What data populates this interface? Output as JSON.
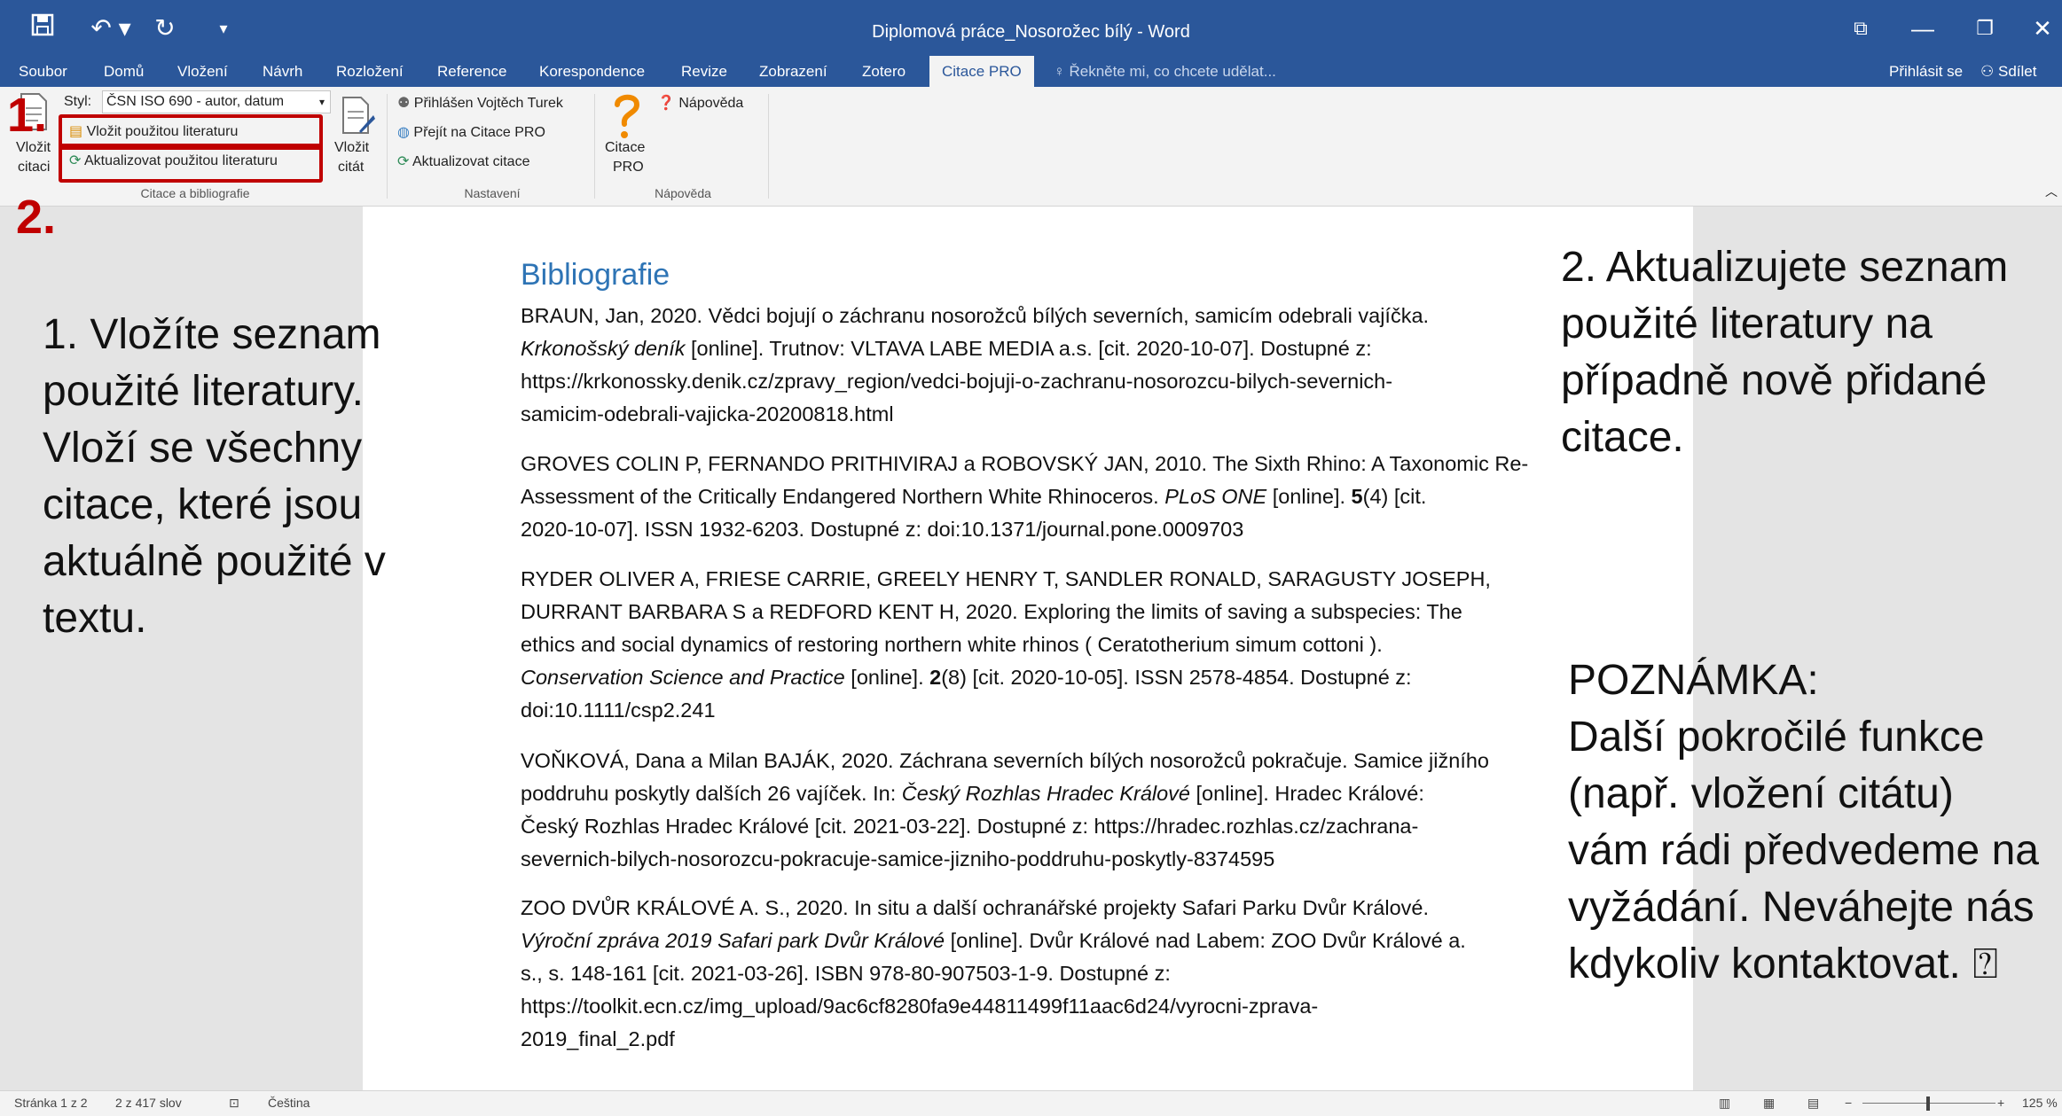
{
  "window": {
    "title": "Diplomová práce_Nosorožec bílý - Word"
  },
  "tabs": [
    "Soubor",
    "Domů",
    "Vložení",
    "Návrh",
    "Rozložení",
    "Reference",
    "Korespondence",
    "Revize",
    "Zobrazení",
    "Zotero",
    "Citace PRO"
  ],
  "tellme": "Řekněte mi, co chcete udělat...",
  "account": {
    "signin": "Přihlásit se",
    "share": "Sdílet"
  },
  "ribbon": {
    "style_label": "Styl:",
    "style_value": "ČSN ISO 690 - autor, datum",
    "insert_citation_label": [
      "Vložit",
      "citaci"
    ],
    "insert_bib": "Vložit použitou literaturu",
    "update_bib": "Aktualizovat použitou literaturu",
    "insert_quote": [
      "Vložit",
      "citát"
    ],
    "group1": "Citace a bibliografie",
    "signed_in": "Přihlášen Vojtěch Turek",
    "goto": "Přejít na Citace PRO",
    "update_citations": "Aktualizovat citace",
    "group2": "Nastavení",
    "citace_pro": [
      "Citace",
      "PRO"
    ],
    "help": "Nápověda",
    "group3": "Nápověda"
  },
  "markers": {
    "one": "1.",
    "two": "2."
  },
  "notes": {
    "left": [
      "1. Vložíte seznam",
      "použité literatury.",
      "Vloží se všechny",
      "citace, které jsou",
      "aktuálně použité v",
      "textu."
    ],
    "right_top": [
      "2. Aktualizujete seznam",
      "použité literatury na",
      "případně nově přidané",
      "citace."
    ],
    "right_bottom": [
      "POZNÁMKA:",
      "Další pokročilé funkce",
      "(např. vložení citátu)",
      "vám rádi předvedeme na",
      "vyžádání. Neváhejte nás",
      "kdykoliv kontaktovat. ⍰"
    ]
  },
  "document": {
    "heading": "Bibliografie",
    "entries": [
      [
        "BRAUN, Jan, 2020. Vědci bojují o záchranu nosorožců bílých severních, samicím odebrali vajíčka.",
        "<i>Krkonošský deník</i> [online]. Trutnov: VLTAVA LABE MEDIA a.s. [cit. 2020-10-07]. Dostupné z:",
        "https://krkonossky.denik.cz/zpravy_region/vedci-bojuji-o-zachranu-nosorozcu-bilych-severnich-",
        "samicim-odebrali-vajicka-20200818.html"
      ],
      [
        "GROVES COLIN P, FERNANDO PRITHIVIRAJ a ROBOVSKÝ JAN, 2010. The Sixth Rhino: A Taxonomic Re-",
        "Assessment of the Critically Endangered Northern White Rhinoceros. <i>PLoS ONE</i> [online]. <b>5</b>(4) [cit.",
        "2020-10-07]. ISSN 1932-6203. Dostupné z: doi:10.1371/journal.pone.0009703"
      ],
      [
        "RYDER OLIVER A, FRIESE CARRIE, GREELY HENRY T, SANDLER RONALD, SARAGUSTY JOSEPH,",
        "DURRANT BARBARA S a REDFORD KENT H, 2020. Exploring the limits of saving a subspecies: The",
        "ethics and social dynamics of restoring northern white rhinos ( Ceratotherium simum cottoni ).",
        "<i>Conservation Science and Practice</i> [online]. <b>2</b>(8) [cit. 2020-10-05]. ISSN 2578-4854. Dostupné z:",
        "doi:10.1111/csp2.241"
      ],
      [
        "VOŇKOVÁ, Dana a Milan BAJÁK, 2020. Záchrana severních bílých nosorožců pokračuje. Samice jižního",
        "poddruhu poskytly dalších 26 vajíček. In: <i>Český Rozhlas Hradec Králové</i> [online]. Hradec Králové:",
        "Český Rozhlas Hradec Králové [cit. 2021-03-22]. Dostupné z: https://hradec.rozhlas.cz/zachrana-",
        "severnich-bilych-nosorozcu-pokracuje-samice-jizniho-poddruhu-poskytly-8374595"
      ],
      [
        "ZOO DVŮR KRÁLOVÉ A. S., 2020. In situ a další ochranářské projekty Safari Parku Dvůr Králové.",
        "<i>Výroční zpráva 2019 Safari park Dvůr Králové</i> [online]. Dvůr Králové nad Labem: ZOO Dvůr Králové a.",
        "s., s. 148-161 [cit. 2021-03-26]. ISBN 978-80-907503-1-9. Dostupné z:",
        "https://toolkit.ecn.cz/img_upload/9ac6cf8280fa9e44811499f11aac6d24/vyrocni-zprava-",
        "2019_final_2.pdf"
      ]
    ]
  },
  "status": {
    "page": "Stránka 1 z 2",
    "words": "2 z 417 slov",
    "lang": "Čeština",
    "zoom": "125 %"
  }
}
